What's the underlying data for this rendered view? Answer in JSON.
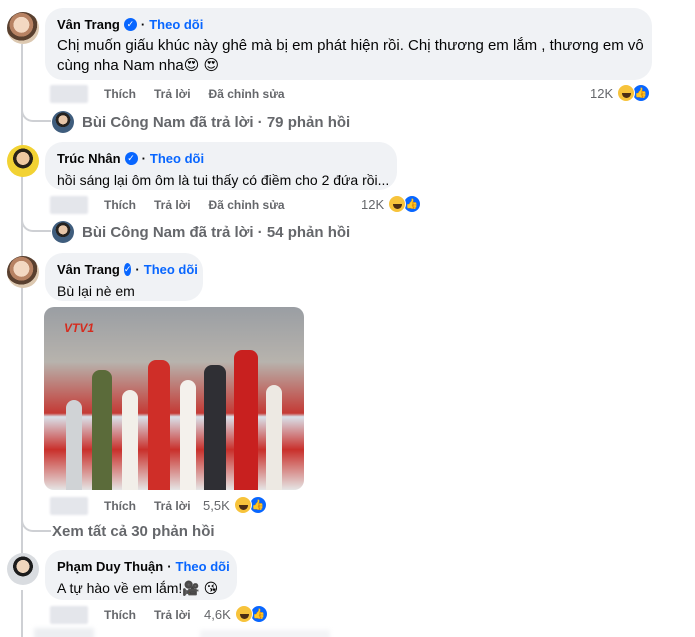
{
  "comments": [
    {
      "author": "Vân Trang",
      "follow_label": "Theo dõi",
      "text_lines": [
        "Chị muốn giấu khúc này ghê mà bị em phát hiện rồi. Chị thương em lắm , thương em vô",
        "cùng nha Nam nha😍 😍"
      ],
      "actions": {
        "like": "Thích",
        "reply": "Trả lời",
        "edited": "Đã chỉnh sửa"
      },
      "reaction_count": "12K",
      "reply_summary": "Bùi Công Nam đã trả lời · 79 phản hồi"
    },
    {
      "author": "Trúc Nhân",
      "follow_label": "Theo dõi",
      "text_lines": [
        "hồi sáng lại ôm ôm là tui thấy có điềm cho 2 đứa rồi..."
      ],
      "actions": {
        "like": "Thích",
        "reply": "Trả lời",
        "edited": "Đã chỉnh sửa"
      },
      "reaction_count": "12K",
      "reply_summary": "Bùi Công Nam đã trả lời · 54 phản hồi"
    },
    {
      "author": "Vân Trang",
      "follow_label": "Theo dõi",
      "text_lines": [
        "Bù lại nè em"
      ],
      "photo_logo": "VTV1",
      "actions": {
        "like": "Thích",
        "reply": "Trả lời"
      },
      "reaction_count": "5,5K"
    },
    {
      "author": "Phạm Duy Thuận",
      "follow_label": "Theo dõi",
      "text_lines": [
        "A tự hào về em lắm!🎥 😘"
      ],
      "actions": {
        "like": "Thích",
        "reply": "Trả lời"
      },
      "reaction_count": "4,6K"
    }
  ],
  "see_all_replies": "Xem tất cả 30 phản hồi",
  "icons": {
    "verified": "✓",
    "like": "👍"
  },
  "colors": {
    "link_blue": "#0866ff",
    "bubble_bg": "#f0f2f5",
    "meta_gray": "#65676b"
  }
}
